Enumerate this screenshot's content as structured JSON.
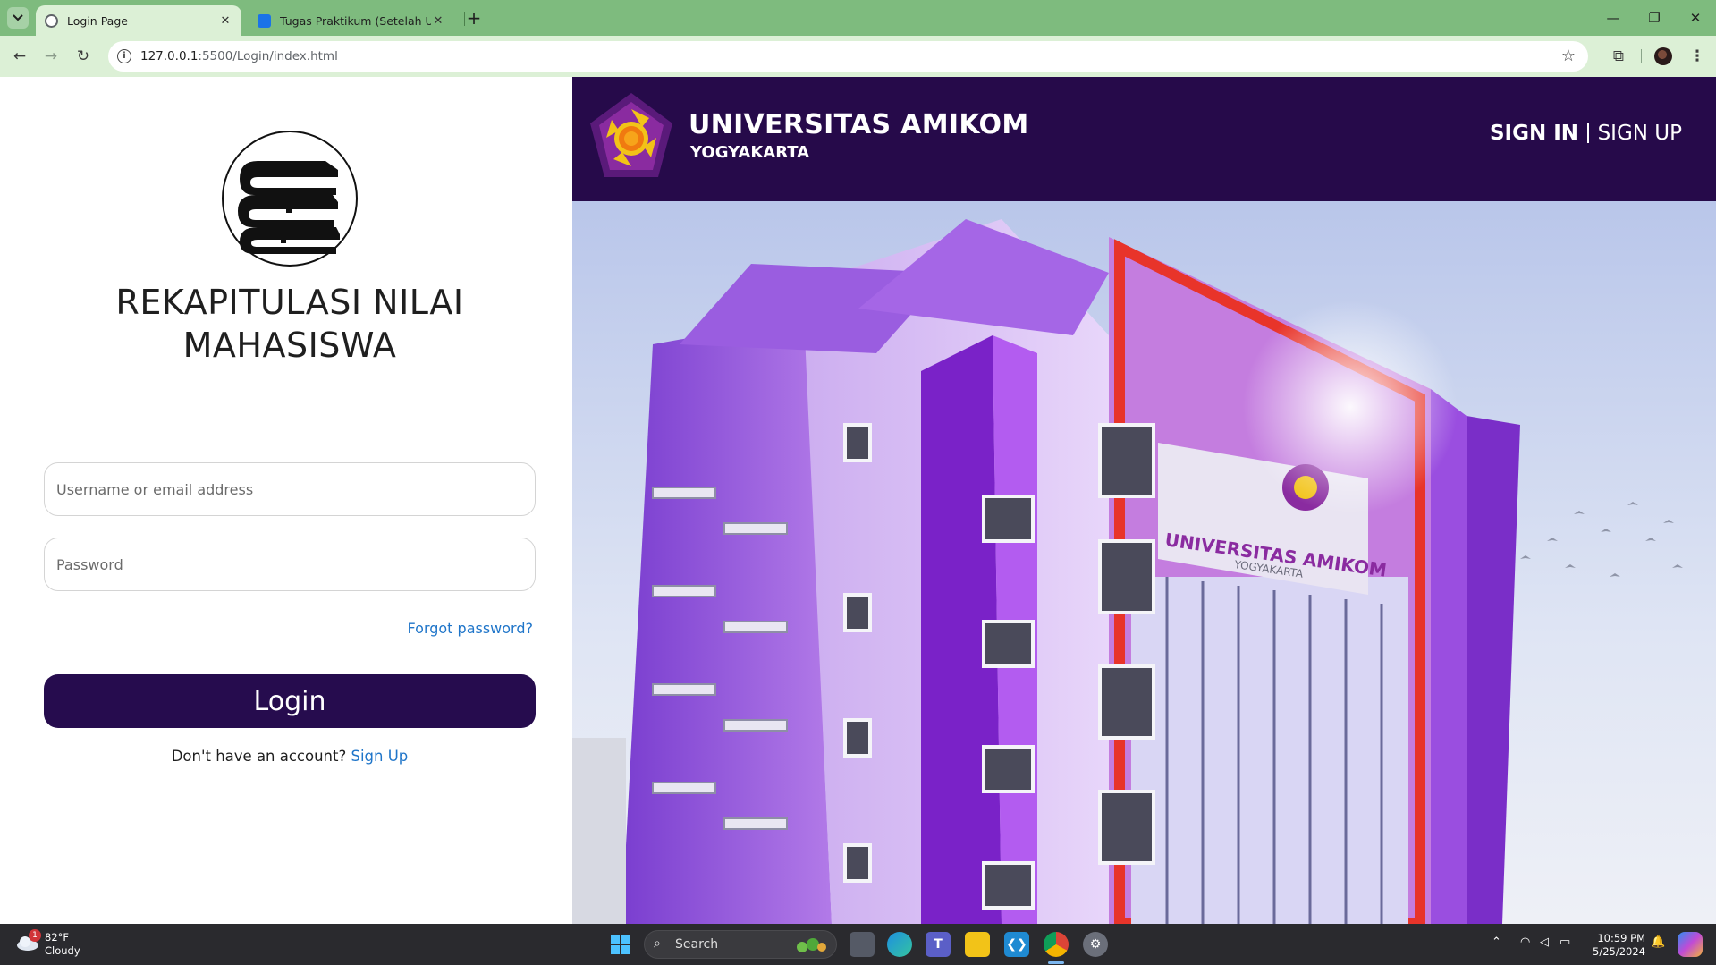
{
  "browser": {
    "tabs": [
      {
        "title": "Login Page",
        "active": true
      },
      {
        "title": "Tugas Praktikum (Setelah UTS)",
        "active": false
      }
    ],
    "url_host": "127.0.0.1",
    "url_rest": ":5500/Login/index.html"
  },
  "login": {
    "title_line1": "REKAPITULASI NILAI",
    "title_line2": "MAHASISWA",
    "username_placeholder": "Username or email address",
    "password_placeholder": "Password",
    "forgot_label": "Forgot password?",
    "login_label": "Login",
    "no_account_text": "Don't have an account?",
    "signup_link": "Sign Up"
  },
  "header": {
    "university": "UNIVERSITAS AMIKOM",
    "city": "YOGYAKARTA",
    "signin_label": "SIGN IN",
    "signup_label": "SIGN UP"
  },
  "building_sign": {
    "line1": "UNIVERSITAS AMIKOM",
    "line2": "YOGYAKARTA"
  },
  "taskbar": {
    "weather_temp": "82°F",
    "weather_cond": "Cloudy",
    "weather_badge": "1",
    "search_label": "Search",
    "time": "10:59 PM",
    "date": "5/25/2024"
  },
  "colors": {
    "brand_purple": "#260a4a",
    "button_purple": "#260c4e",
    "link_blue": "#1f75c9",
    "chrome_green": "#7ebb7e"
  },
  "icons": [
    "books-icon",
    "amikom-logo",
    "search-icon",
    "windows-start-icon"
  ]
}
